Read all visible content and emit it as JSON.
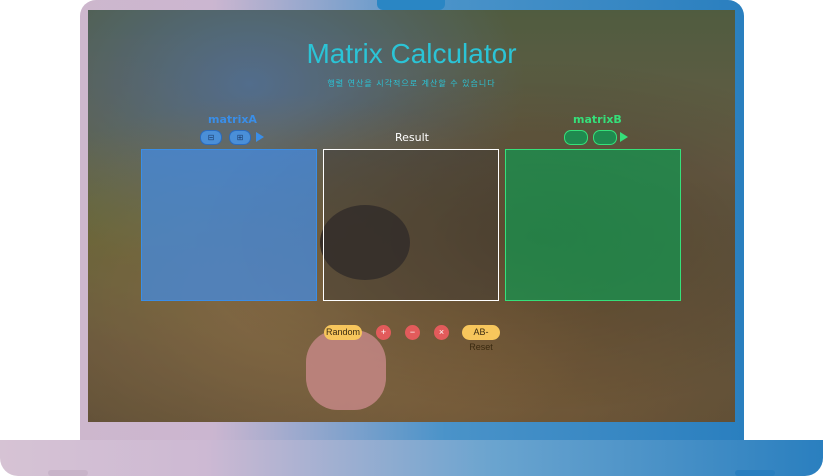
{
  "app": {
    "title": "Matrix Calculator",
    "subtitle": "행렬 연산을 시각적으로 계산할 수 있습니다"
  },
  "matrices": {
    "a_label": "matrixA",
    "result_label": "Result",
    "b_label": "matrixB",
    "a_controls": [
      "⊟",
      "⊞"
    ],
    "b_controls": [
      "",
      ""
    ]
  },
  "actions": {
    "random": "Random",
    "add": "+",
    "subtract": "−",
    "multiply": "×",
    "reset": "AB-Reset"
  },
  "colors": {
    "accent_title": "#2bc4d6",
    "matrix_a": "#3a8ee8",
    "matrix_b": "#35e07a",
    "operation": "#e25b5b",
    "utility": "#f7c65c"
  }
}
